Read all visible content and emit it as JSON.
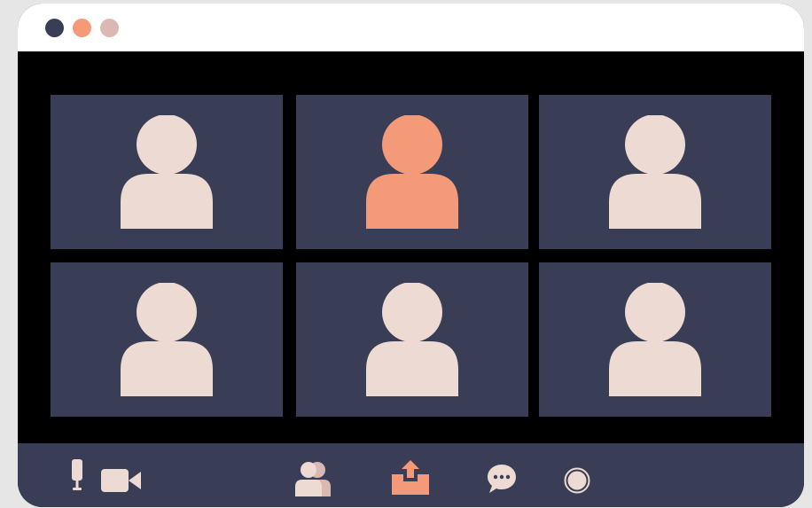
{
  "window": {
    "controls": [
      {
        "name": "close",
        "color": "#3a3d56"
      },
      {
        "name": "minimize",
        "color": "#f59a78"
      },
      {
        "name": "maximize",
        "color": "#dbb9b2"
      }
    ]
  },
  "participants": [
    {
      "icon": "person-avatar-icon",
      "active_speaker": false,
      "color": "#ecdad3"
    },
    {
      "icon": "person-avatar-icon",
      "active_speaker": true,
      "color": "#f59a78"
    },
    {
      "icon": "person-avatar-icon",
      "active_speaker": false,
      "color": "#ecdad3"
    },
    {
      "icon": "person-avatar-icon",
      "active_speaker": false,
      "color": "#ecdad3"
    },
    {
      "icon": "person-avatar-icon",
      "active_speaker": false,
      "color": "#ecdad3"
    },
    {
      "icon": "person-avatar-icon",
      "active_speaker": false,
      "color": "#ecdad3"
    }
  ],
  "toolbar": {
    "buttons": [
      {
        "icon": "microphone-icon"
      },
      {
        "icon": "video-camera-icon"
      },
      {
        "icon": "participants-icon"
      },
      {
        "icon": "share-screen-icon",
        "highlighted": true
      },
      {
        "icon": "chat-icon"
      },
      {
        "icon": "record-icon"
      }
    ]
  },
  "colors": {
    "window_bg": "#000000",
    "titlebar_bg": "#ffffff",
    "tile_bg": "#3a3d56",
    "toolbar_bg": "#3a3d56",
    "avatar": "#ecdad3",
    "accent": "#f59a78"
  }
}
